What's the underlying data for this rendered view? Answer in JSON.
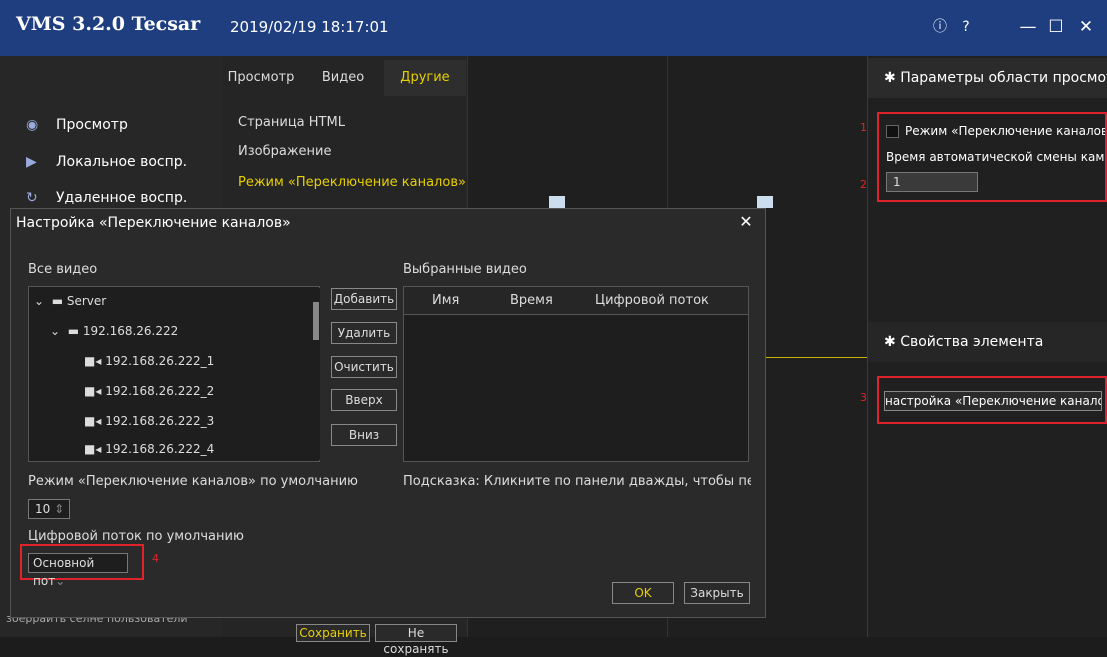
{
  "app": {
    "title": "VMS 3.2.0 Tecsar",
    "datetime": "2019/02/19 18:17:01"
  },
  "window_icons": [
    "info-icon",
    "help-icon",
    "minimize-icon",
    "maximize-icon",
    "close-icon"
  ],
  "window_buttons": {
    "info": "ⓘ",
    "help": "?",
    "minimize": "—",
    "maximize": "☐",
    "close": "✕"
  },
  "nav": [
    {
      "label": "Просмотр",
      "icon": "◉"
    },
    {
      "label": "Локальное воспр.",
      "icon": "▶"
    },
    {
      "label": "Удаленное воспр.",
      "icon": "↻"
    }
  ],
  "tabs": [
    {
      "label": "Просмотр"
    },
    {
      "label": "Видео"
    },
    {
      "label": "Другие"
    }
  ],
  "submenu": [
    {
      "label": "Страница HTML"
    },
    {
      "label": "Изображение"
    },
    {
      "label": "Режим «Переключение каналов»"
    }
  ],
  "right_panel": {
    "view_area_title": "Параметры области просмотра",
    "mode_checkbox_label": "Режим «Переключение каналов»",
    "auto_switch_label": "Время автоматической смены камер",
    "auto_switch_value": "1",
    "element_props_title": "Свойства элемента",
    "settings_button": "настройка «Переключение каналов»"
  },
  "markers": {
    "m1": "1",
    "m2": "2",
    "m3": "3",
    "m4": "4"
  },
  "dialog": {
    "title": "Настройка «Переключение каналов»",
    "close": "✕",
    "all_videos_label": "Все видео",
    "selected_videos_label": "Выбранные видео",
    "tree": {
      "root": "Server",
      "device": "192.168.26.222",
      "channels": [
        "192.168.26.222_1",
        "192.168.26.222_2",
        "192.168.26.222_3",
        "192.168.26.222_4"
      ]
    },
    "buttons": {
      "add": "Добавить",
      "remove": "Удалить",
      "clear": "Очистить",
      "up": "Вверх",
      "down": "Вниз",
      "ok": "OK",
      "close_btn": "Закрыть"
    },
    "columns": [
      "Имя",
      "Время",
      "Цифровой поток"
    ],
    "default_mode_label": "Режим «Переключение каналов» по умолчанию",
    "default_mode_value": "10",
    "default_stream_label": "Цифровой поток по умолчанию",
    "default_stream_value": "Основной пот",
    "hint": "Подсказка: Кликните по панели дважды, чтобы перейти в р"
  },
  "background_fragments": {
    "left_bottom": "зберраить селне пользователи",
    "save": "Сохранить",
    "no_save": "Не сохранять"
  },
  "colors": {
    "titlebar": "#1e3e80",
    "active_tab": "#e8d000",
    "red_marker": "#e0232a"
  }
}
